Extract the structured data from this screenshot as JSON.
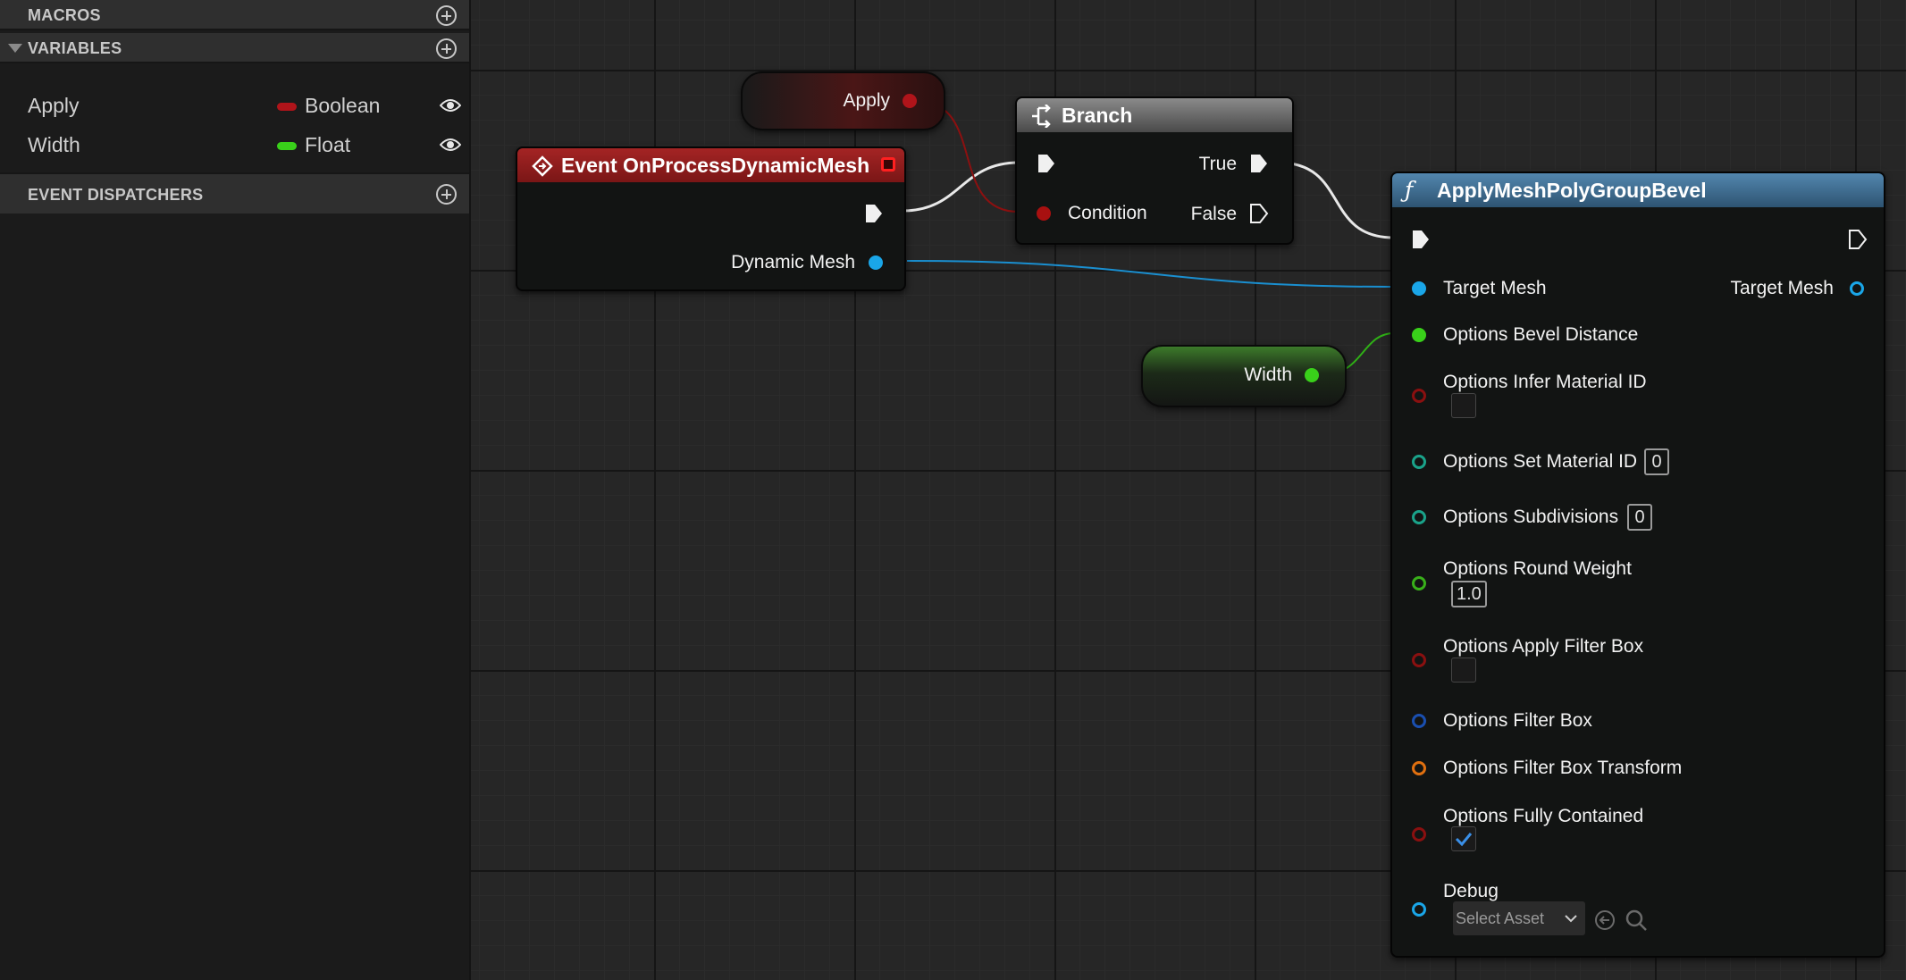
{
  "sidebar": {
    "macros": {
      "title": "MACROS"
    },
    "variables": {
      "title": "VARIABLES",
      "items": [
        {
          "name": "Apply",
          "type": "Boolean",
          "color": "#b0141a"
        },
        {
          "name": "Width",
          "type": "Float",
          "color": "#39d01a"
        }
      ]
    },
    "event_dispatchers": {
      "title": "EVENT DISPATCHERS"
    }
  },
  "graph": {
    "apply_node": {
      "label": "Apply",
      "pin_color": "#b0141a"
    },
    "event_node": {
      "title": "Event OnProcessDynamicMesh",
      "header_color": "#8c1c1c",
      "pin_label": "Dynamic Mesh",
      "pin_color": "#1aa6e8"
    },
    "branch_node": {
      "title": "Branch",
      "condition_label": "Condition",
      "true_label": "True",
      "false_label": "False"
    },
    "width_node": {
      "label": "Width",
      "pin_color": "#39d01a"
    },
    "function_node": {
      "title": "ApplyMeshPolyGroupBevel",
      "header_color": "#3c6e94",
      "target_mesh_in": "Target Mesh",
      "target_mesh_out": "Target Mesh",
      "bevel_distance": "Options Bevel Distance",
      "infer_material_id": "Options Infer Material ID",
      "set_material_id": "Options Set Material ID",
      "set_material_id_value": "0",
      "subdivisions": "Options Subdivisions",
      "subdivisions_value": "0",
      "round_weight": "Options Round Weight",
      "round_weight_value": "1.0",
      "apply_filter_box": "Options Apply Filter Box",
      "filter_box": "Options Filter Box",
      "filter_box_transform": "Options Filter Box Transform",
      "fully_contained": "Options Fully Contained",
      "debug": "Debug",
      "debug_placeholder": "Select Asset"
    }
  },
  "colors": {
    "bool": "#b0141a",
    "float": "#39d01a",
    "object": "#1aa6e8",
    "int": "#1aa38a",
    "struct_blue": "#1a4fb0",
    "transform": "#e07010"
  }
}
